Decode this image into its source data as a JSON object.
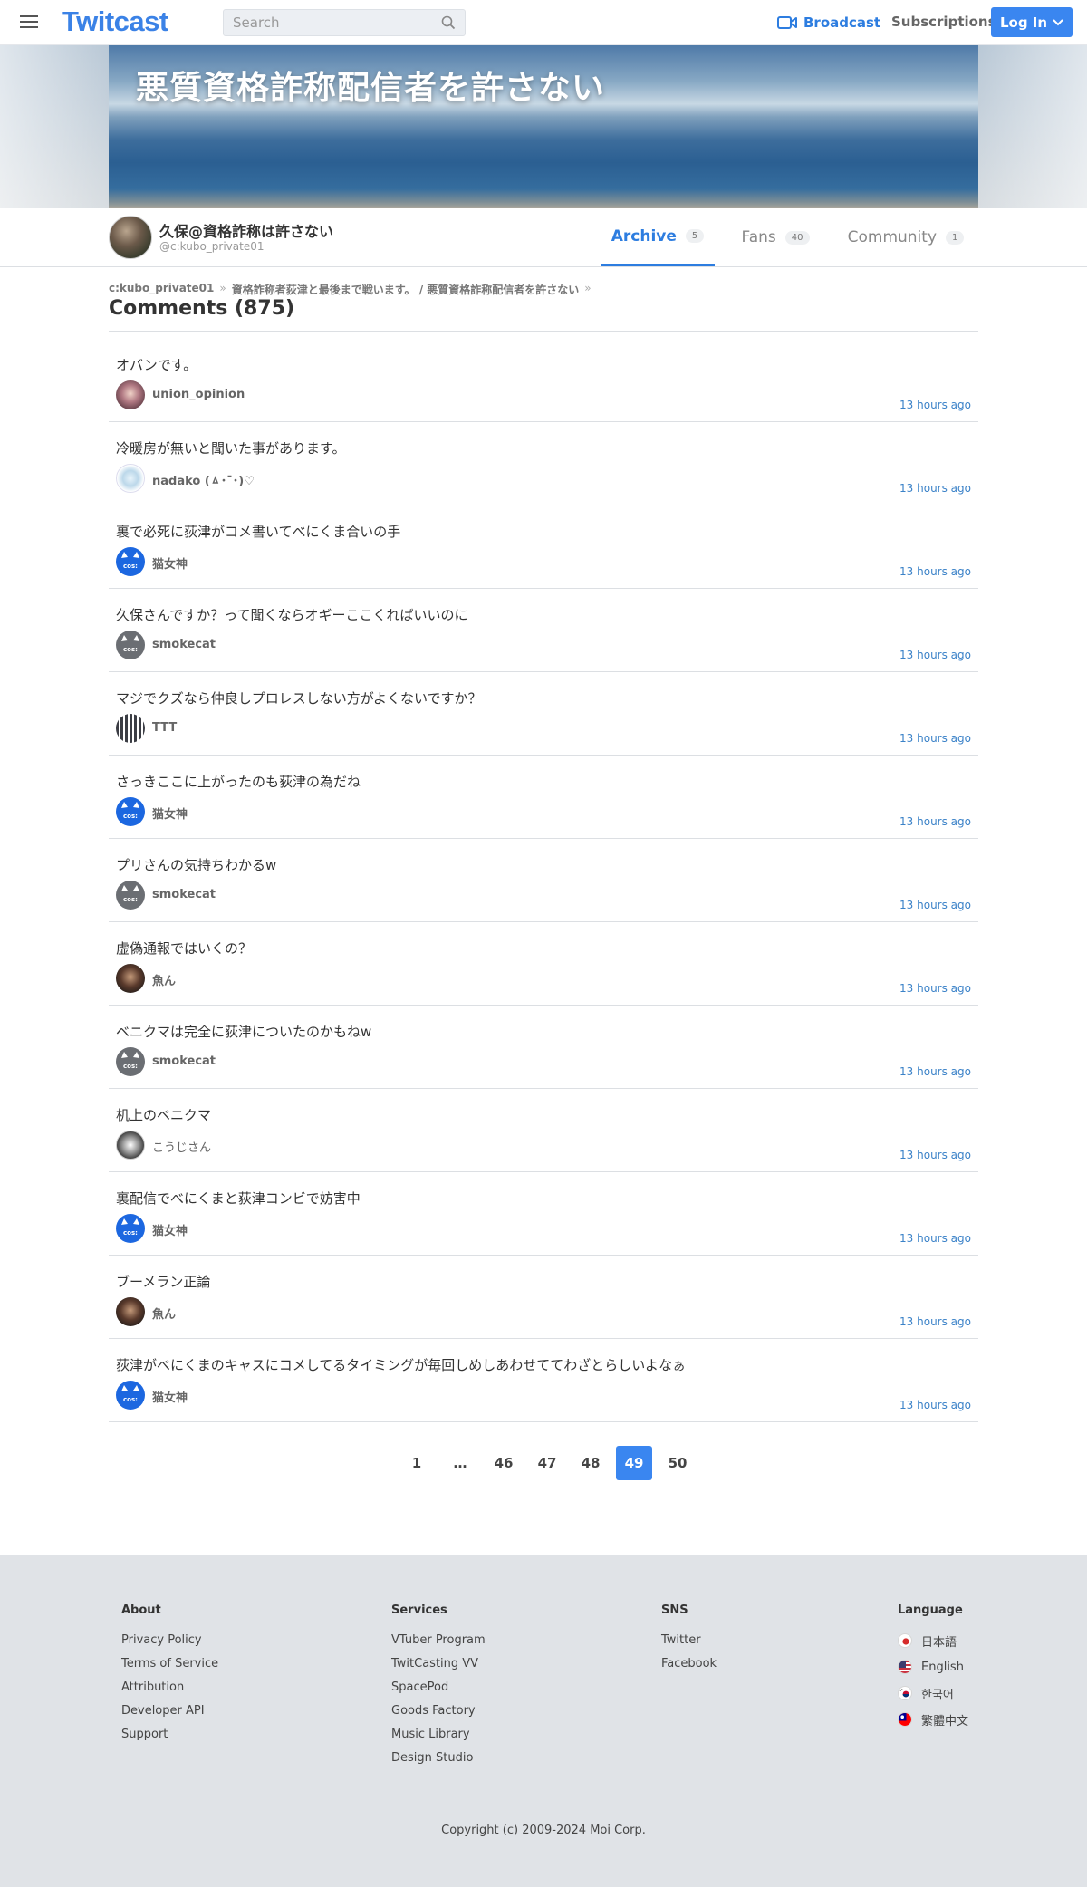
{
  "header": {
    "logo": "Twitcast",
    "search_placeholder": "Search",
    "broadcast_label": "Broadcast",
    "subscriptions_label": "Subscriptions",
    "login_label": "Log In"
  },
  "banner": {
    "title": "悪質資格詐称配信者を許さない"
  },
  "profile": {
    "name": "久保@資格詐称は許さない",
    "id": "@c:kubo_private01",
    "tabs": [
      {
        "label": "Archive",
        "count": "5"
      },
      {
        "label": "Fans",
        "count": "40"
      },
      {
        "label": "Community",
        "count": "1"
      }
    ]
  },
  "breadcrumb": {
    "items": [
      "c:kubo_private01",
      "資格詐称者荻津と最後まで戦います。 / 悪質資格詐称配信者を許さない"
    ],
    "separator": "»"
  },
  "heading": "Comments (875)",
  "comments": [
    {
      "text": "オバンです。",
      "user": "union_opinion",
      "time": "13 hours ago"
    },
    {
      "text": "冷暖房が無いと聞いた事があります。",
      "user": "nadako (ㅿ･¯･)♡",
      "time": "13 hours ago"
    },
    {
      "text": "裏で必死に荻津がコメ書いてべにくま合いの手",
      "user": "猫女神",
      "time": "13 hours ago"
    },
    {
      "text": "久保さんですか？って聞くならオギーここくればいいのに",
      "user": "smokecat",
      "time": "13 hours ago"
    },
    {
      "text": "マジでクズなら仲良しプロレスしない方がよくないですか？",
      "user": "TTT",
      "time": "13 hours ago"
    },
    {
      "text": "さっきここに上がったのも荻津の為だね",
      "user": "猫女神",
      "time": "13 hours ago"
    },
    {
      "text": "プリさんの気持ちわかるw",
      "user": "smokecat",
      "time": "13 hours ago"
    },
    {
      "text": "虚偽通報ではいくの？",
      "user": "魚ん",
      "time": "13 hours ago"
    },
    {
      "text": "ベニクマは完全に荻津についたのかもねw",
      "user": "smokecat",
      "time": "13 hours ago"
    },
    {
      "text": "机上のベニクマ",
      "user": "こうじさん",
      "time": "13 hours ago"
    },
    {
      "text": "裏配信でべにくまと荻津コンビで妨害中",
      "user": "猫女神",
      "time": "13 hours ago"
    },
    {
      "text": "ブーメラン正論",
      "user": "魚ん",
      "time": "13 hours ago"
    },
    {
      "text": "荻津がべにくまのキャスにコメしてるタイミングが毎回しめしあわせててわざとらしいよなぁ",
      "user": "猫女神",
      "time": "13 hours ago"
    }
  ],
  "avatar_badge": "cos:",
  "pagination": {
    "pages": [
      "1",
      "…",
      "46",
      "47",
      "48",
      "49",
      "50"
    ],
    "current": "49"
  },
  "footer": {
    "about": {
      "title": "About",
      "links": [
        "Privacy Policy",
        "Terms of Service",
        "Attribution",
        "Developer API",
        "Support"
      ]
    },
    "services": {
      "title": "Services",
      "links": [
        "VTuber Program",
        "TwitCasting VV",
        "SpacePod",
        "Goods Factory",
        "Music Library",
        "Design Studio"
      ]
    },
    "sns": {
      "title": "SNS",
      "links": [
        "Twitter",
        "Facebook"
      ]
    },
    "language": {
      "title": "Language",
      "items": [
        "日本語",
        "English",
        "한국어",
        "繁體中文"
      ]
    },
    "copyright": "Copyright (c) 2009-2024 Moi Corp."
  },
  "colors": {
    "brand": "#3b82e6",
    "link": "#2d7de0",
    "login_bg": "#3a86f0",
    "footer_bg": "#e0e3e7"
  }
}
